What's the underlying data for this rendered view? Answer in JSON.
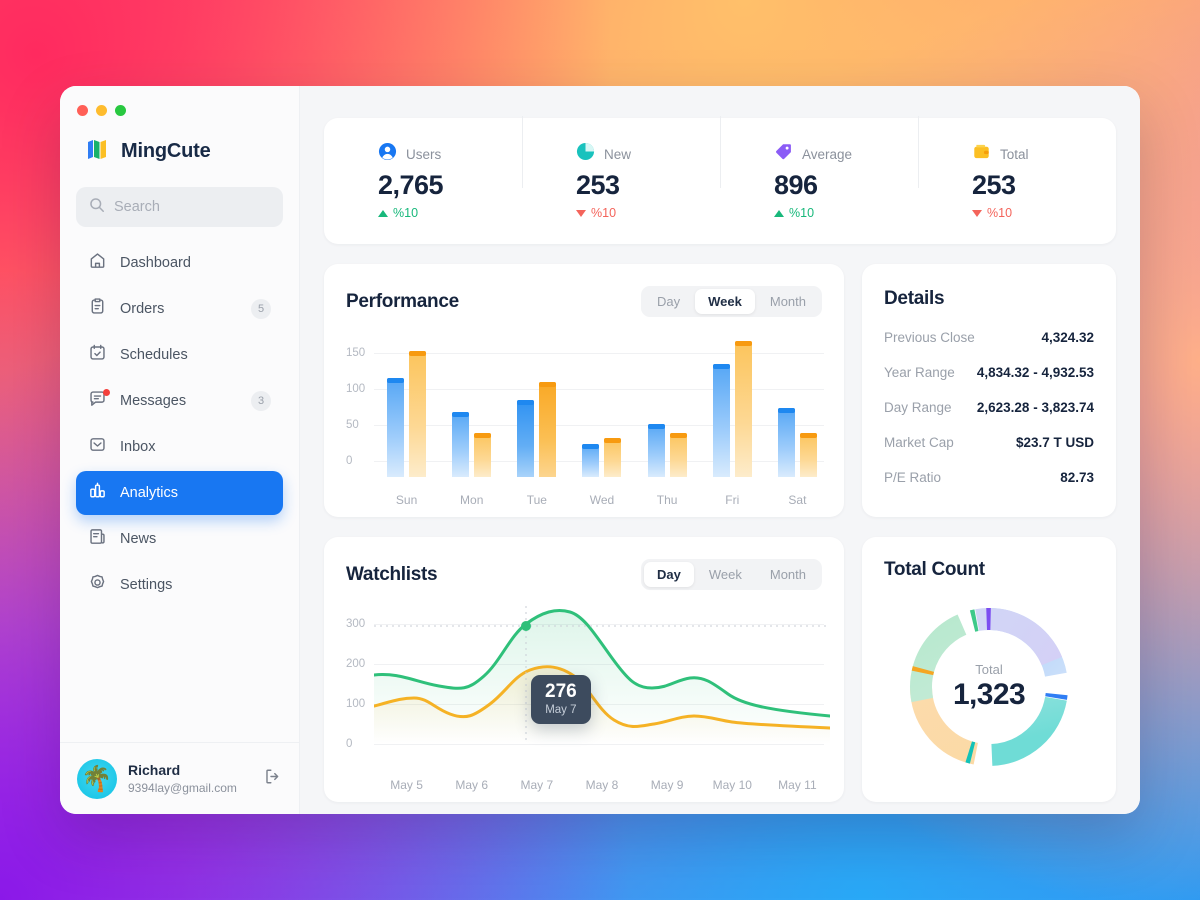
{
  "window": {
    "traffic_lights": [
      "close",
      "minimize",
      "zoom"
    ]
  },
  "sidebar": {
    "brand": "MingCute",
    "search": {
      "placeholder": "Search"
    },
    "items": [
      {
        "label": "Dashboard",
        "icon": "home-icon",
        "badge": "",
        "active": false,
        "dot": false
      },
      {
        "label": "Orders",
        "icon": "clipboard-icon",
        "badge": "5",
        "active": false,
        "dot": false
      },
      {
        "label": "Schedules",
        "icon": "calendar-check-icon",
        "badge": "",
        "active": false,
        "dot": false
      },
      {
        "label": "Messages",
        "icon": "message-icon",
        "badge": "3",
        "active": false,
        "dot": true
      },
      {
        "label": "Inbox",
        "icon": "inbox-icon",
        "badge": "",
        "active": false,
        "dot": false
      },
      {
        "label": "Analytics",
        "icon": "bar-chart-icon",
        "badge": "",
        "active": true,
        "dot": false
      },
      {
        "label": "News",
        "icon": "news-icon",
        "badge": "",
        "active": false,
        "dot": false
      },
      {
        "label": "Settings",
        "icon": "gear-icon",
        "badge": "",
        "active": false,
        "dot": false
      }
    ],
    "user": {
      "name": "Richard",
      "email": "9394lay@gmail.com",
      "logout_icon": "logout-icon"
    }
  },
  "stats": [
    {
      "label": "Users",
      "value": "2,765",
      "delta": "%10",
      "direction": "up",
      "icon": "user-circle-icon",
      "color": "#1877f2"
    },
    {
      "label": "New",
      "value": "253",
      "delta": "%10",
      "direction": "down",
      "icon": "pie-chart-icon",
      "color": "#19c2bd"
    },
    {
      "label": "Average",
      "value": "896",
      "delta": "%10",
      "direction": "up",
      "icon": "tag-icon",
      "color": "#8b5cf6"
    },
    {
      "label": "Total",
      "value": "253",
      "delta": "%10",
      "direction": "down",
      "icon": "wallet-icon",
      "color": "#fbbf24"
    }
  ],
  "performance": {
    "title": "Performance",
    "tabs": [
      {
        "label": "Day",
        "active": false
      },
      {
        "label": "Week",
        "active": true
      },
      {
        "label": "Month",
        "active": false
      }
    ]
  },
  "details": {
    "title": "Details",
    "rows": [
      {
        "label": "Previous Close",
        "value": "4,324.32"
      },
      {
        "label": "Year Range",
        "value": "4,834.32 - 4,932.53"
      },
      {
        "label": "Day Range",
        "value": "2,623.28 - 3,823.74"
      },
      {
        "label": "Market Cap",
        "value": "$23.7 T USD"
      },
      {
        "label": "P/E Ratio",
        "value": "82.73"
      }
    ]
  },
  "watchlists": {
    "title": "Watchlists",
    "tabs": [
      {
        "label": "Day",
        "active": true
      },
      {
        "label": "Week",
        "active": false
      },
      {
        "label": "Month",
        "active": false
      }
    ],
    "tooltip": {
      "value": "276",
      "date": "May 7"
    }
  },
  "total_count": {
    "title": "Total Count",
    "center_label": "Total",
    "center_value": "1,323"
  },
  "chart_data": [
    {
      "type": "bar",
      "title": "Performance",
      "categories": [
        "Sun",
        "Mon",
        "Tue",
        "Wed",
        "Thu",
        "Fri",
        "Sat"
      ],
      "series": [
        {
          "name": "Blue",
          "color": "#3e9bf4",
          "values": [
            125,
            83,
            98,
            42,
            67,
            143,
            88
          ]
        },
        {
          "name": "Orange",
          "color": "#fbbd4c",
          "values": [
            160,
            56,
            120,
            49,
            56,
            173,
            56
          ]
        }
      ],
      "xlabel": "",
      "ylabel": "",
      "yticks": [
        0,
        50,
        100,
        150
      ],
      "ylim": [
        0,
        180
      ],
      "grid": true,
      "legend": "none"
    },
    {
      "type": "line",
      "title": "Watchlists",
      "categories": [
        "May 5",
        "May 6",
        "May 7",
        "May 8",
        "May 9",
        "May 10",
        "May 11"
      ],
      "series": [
        {
          "name": "Green",
          "color": "#2fc07a",
          "values": [
            190,
            155,
            276,
            360,
            180,
            190,
            115
          ]
        },
        {
          "name": "Orange",
          "color": "#f5b225",
          "values": [
            112,
            75,
            150,
            210,
            60,
            70,
            55
          ]
        }
      ],
      "xlabel": "",
      "ylabel": "",
      "yticks": [
        0,
        100,
        200,
        300
      ],
      "ylim": [
        0,
        380
      ],
      "grid": true,
      "legend": "none",
      "annotation": {
        "value": "276",
        "date": "May 7",
        "series": "Green"
      }
    },
    {
      "type": "pie",
      "title": "Total Count",
      "center_label": "Total",
      "center_value": "1,323",
      "labels": [
        "Blue",
        "Teal",
        "Orange",
        "Green",
        "Purple"
      ],
      "values": [
        22,
        22,
        20,
        14,
        22
      ],
      "colors": [
        "#4a90f0",
        "#22c8c0",
        "#f5a623",
        "#3ec98a",
        "#8b5cf6"
      ],
      "donut": true
    }
  ]
}
